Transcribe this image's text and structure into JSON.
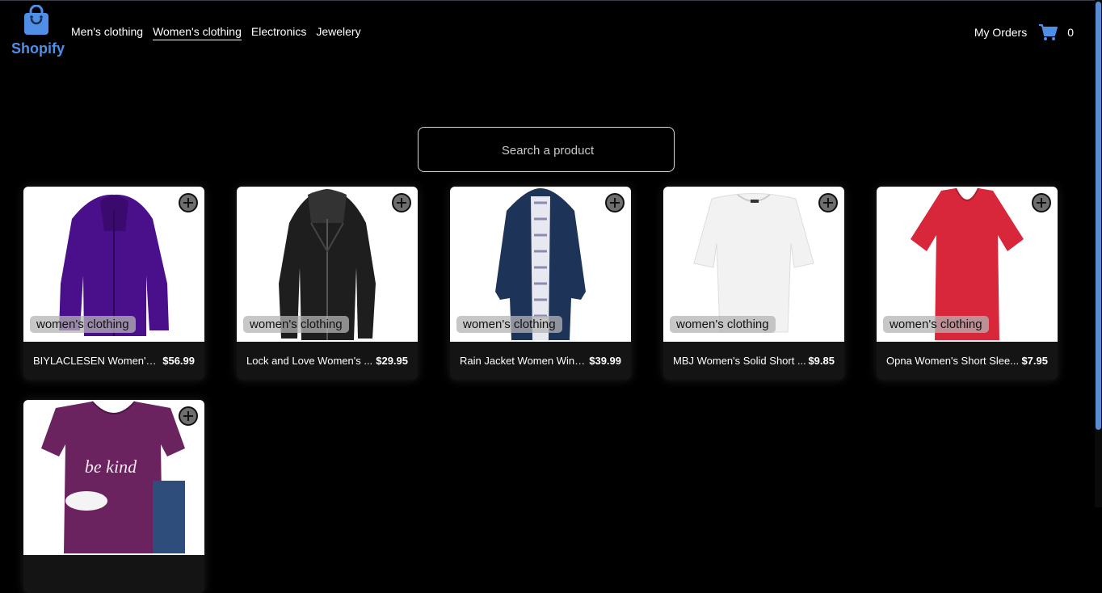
{
  "brand": {
    "name": "Shopify"
  },
  "nav": {
    "items": [
      {
        "label": "Men's clothing",
        "active": false
      },
      {
        "label": "Women's clothing",
        "active": true
      },
      {
        "label": "Electronics",
        "active": false
      },
      {
        "label": "Jewelery",
        "active": false
      }
    ]
  },
  "header": {
    "orders_label": "My Orders",
    "cart_count": "0"
  },
  "search": {
    "placeholder": "Search a product",
    "value": ""
  },
  "products": [
    {
      "title": "BIYLACLESEN Women's 3...",
      "price": "$56.99",
      "category": "women's clothing",
      "image": "purple-jacket"
    },
    {
      "title": "Lock and Love Women's ...",
      "price": "$29.95",
      "category": "women's clothing",
      "image": "black-leather-jacket"
    },
    {
      "title": "Rain Jacket Women Wind...",
      "price": "$39.99",
      "category": "women's clothing",
      "image": "navy-rain-jacket"
    },
    {
      "title": "MBJ Women's Solid Short ...",
      "price": "$9.85",
      "category": "women's clothing",
      "image": "white-top"
    },
    {
      "title": "Opna Women's Short Slee...",
      "price": "$7.95",
      "category": "women's clothing",
      "image": "red-tshirt"
    },
    {
      "title": "",
      "price": "",
      "category": "",
      "image": "purple-be-kind-tee",
      "image_text": "be kind"
    }
  ],
  "colors": {
    "brand": "#4f8fe8",
    "background": "#000000",
    "card": "#141414"
  }
}
